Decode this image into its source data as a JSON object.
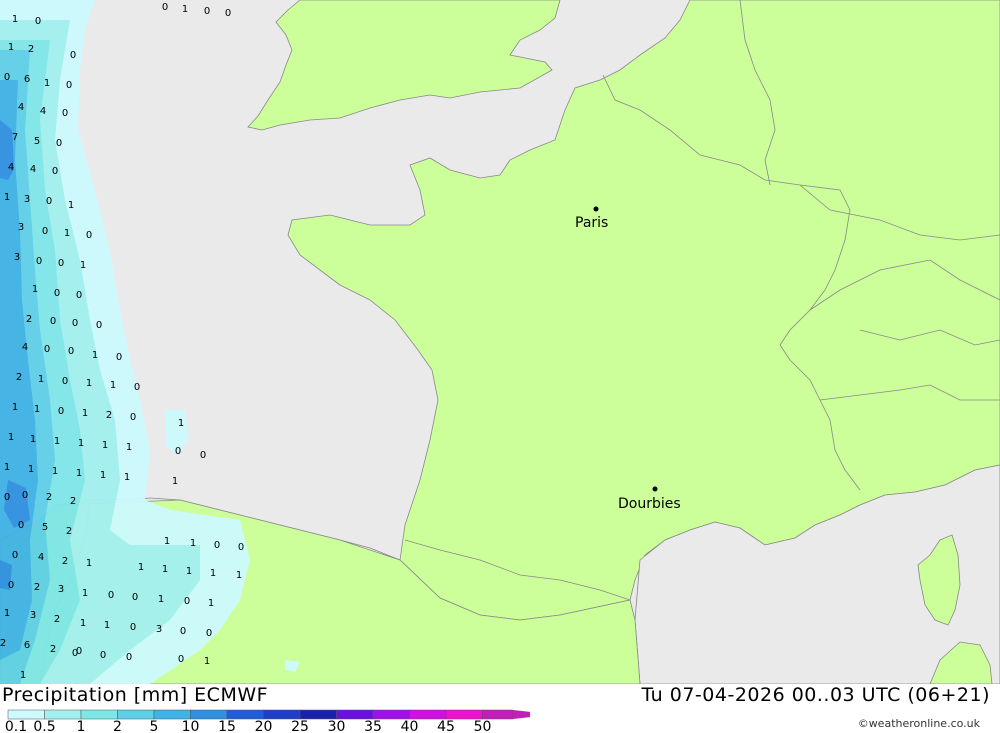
{
  "footer": {
    "title": "Precipitation [mm] ECMWF",
    "datetime": "Tu 07-04-2026 00..03 UTC (06+21)",
    "credit": "©weatheronline.co.uk"
  },
  "legend": {
    "values": [
      "0.1",
      "0.5",
      "1",
      "2",
      "5",
      "10",
      "15",
      "20",
      "25",
      "30",
      "35",
      "40",
      "45",
      "50"
    ],
    "colors": [
      "#ccfaff",
      "#a3f0f0",
      "#7fe6e8",
      "#5fcfe8",
      "#3fb2e6",
      "#2f8fe0",
      "#1f5ed8",
      "#1d3fc8",
      "#1a22a8",
      "#6a10e0",
      "#a010e8",
      "#d010e0",
      "#f010d0",
      "#c020b8"
    ]
  },
  "map": {
    "sea_color": "#eaeaea",
    "land_color": "#ccff99",
    "border_color": "#888888",
    "cities": [
      {
        "name": "Paris"
      },
      {
        "name": "Dourbies"
      }
    ],
    "precip_values": [
      "1",
      "0",
      "0",
      "1",
      "0",
      "0",
      "1",
      "2",
      "0",
      "0",
      "6",
      "1",
      "0",
      "4",
      "4",
      "0",
      "7",
      "5",
      "0",
      "4",
      "4",
      "0",
      "1",
      "3",
      "0",
      "1",
      "3",
      "0",
      "1",
      "0",
      "3",
      "0",
      "0",
      "1",
      "1",
      "0",
      "0",
      "2",
      "0",
      "0",
      "0",
      "4",
      "0",
      "0",
      "1",
      "0",
      "2",
      "1",
      "0",
      "1",
      "1",
      "0",
      "1",
      "1",
      "0",
      "1",
      "2",
      "0",
      "1",
      "1",
      "1",
      "1",
      "1",
      "1",
      "1",
      "1",
      "1",
      "1",
      "1",
      "1",
      "1",
      "0",
      "0",
      "1",
      "0",
      "0",
      "2",
      "2",
      "0",
      "5",
      "2",
      "1",
      "1",
      "0",
      "0",
      "0",
      "4",
      "2",
      "1",
      "1",
      "1",
      "1",
      "1",
      "1",
      "0",
      "2",
      "3",
      "1",
      "0",
      "0",
      "1",
      "0",
      "1",
      "1",
      "3",
      "2",
      "1",
      "1",
      "0",
      "3",
      "0",
      "0",
      "2",
      "6",
      "2",
      "0",
      "0",
      "0",
      "0",
      "1",
      "1",
      "0",
      "2"
    ]
  }
}
